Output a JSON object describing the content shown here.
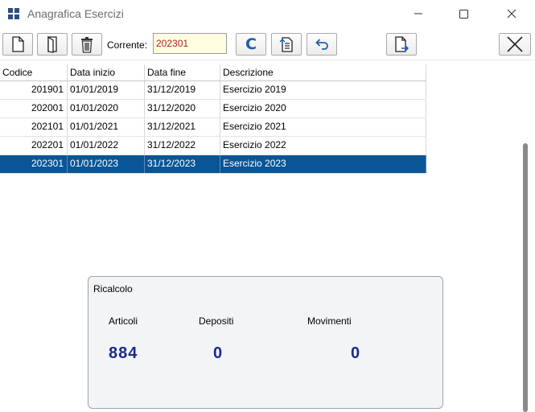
{
  "window": {
    "title": "Anagrafica Esercizi"
  },
  "toolbar": {
    "corrente_label": "Corrente:",
    "corrente_value": "202301",
    "calc_button_glyph": "C",
    "buttons": [
      "new-document-icon",
      "open-document-icon",
      "trash-icon",
      "calc-c-icon",
      "document-list-icon",
      "undo-arrow-icon",
      "document-export-icon",
      "close-x-icon"
    ]
  },
  "grid": {
    "headers": [
      "Codice",
      "Data inizio",
      "Data fine",
      "Descrizione"
    ],
    "rows": [
      [
        "201901",
        "01/01/2019",
        "31/12/2019",
        "Esercizio 2019"
      ],
      [
        "202001",
        "01/01/2020",
        "31/12/2020",
        "Esercizio 2020"
      ],
      [
        "202101",
        "01/01/2021",
        "31/12/2021",
        "Esercizio 2021"
      ],
      [
        "202201",
        "01/01/2022",
        "31/12/2022",
        "Esercizio 2022"
      ],
      [
        "202301",
        "01/01/2023",
        "31/12/2023",
        "Esercizio 2023"
      ]
    ],
    "selected_row": 4
  },
  "ricalcolo": {
    "title": "Ricalcolo",
    "articoli_label": "Articoli",
    "depositi_label": "Depositi",
    "movimenti_label": "Movimenti",
    "articoli_value": "884",
    "depositi_value": "0",
    "movimenti_value": "0"
  },
  "colors": {
    "selection": "#0a5596",
    "accent_blue": "#1f5fa8",
    "value_blue": "#1a2b8c",
    "input_bg": "#fffde0"
  }
}
